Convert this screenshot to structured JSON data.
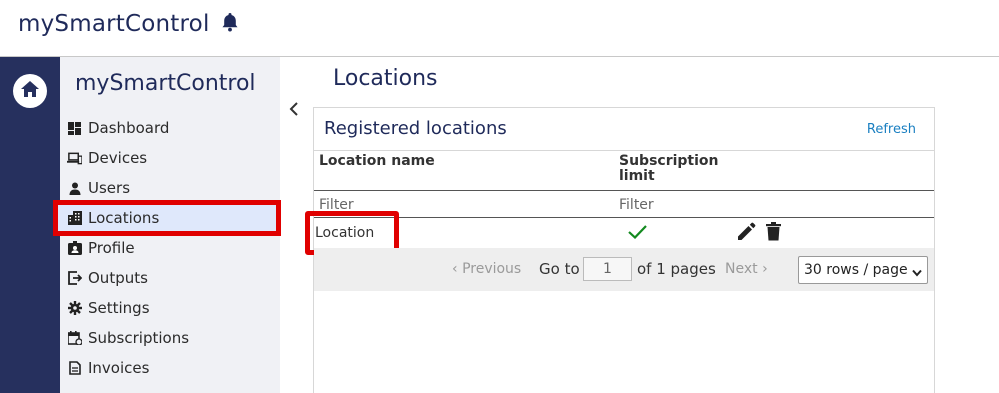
{
  "header": {
    "app_title": "mySmartControl"
  },
  "sidebar": {
    "title": "mySmartControl",
    "items": [
      {
        "label": "Dashboard",
        "icon": "dashboard-icon"
      },
      {
        "label": "Devices",
        "icon": "devices-icon"
      },
      {
        "label": "Users",
        "icon": "user-icon"
      },
      {
        "label": "Locations",
        "icon": "building-icon",
        "active": true
      },
      {
        "label": "Profile",
        "icon": "id-badge-icon"
      },
      {
        "label": "Outputs",
        "icon": "export-icon"
      },
      {
        "label": "Settings",
        "icon": "gear-icon"
      },
      {
        "label": "Subscriptions",
        "icon": "calendar-icon"
      },
      {
        "label": "Invoices",
        "icon": "invoice-icon"
      }
    ]
  },
  "main": {
    "page_title": "Locations",
    "panel": {
      "title": "Registered locations",
      "refresh": "Refresh",
      "columns": {
        "location_name": "Location name",
        "subscription_limit_1": "Subscription",
        "subscription_limit_2": "limit"
      },
      "filters": {
        "location_name": "Filter",
        "subscription_limit": "Filter"
      },
      "rows": [
        {
          "location_name": "Location",
          "subscription_limit": true
        }
      ],
      "pager": {
        "previous": "Previous",
        "goto": "Go to",
        "page": "1",
        "of_pages": "of 1 pages",
        "next": "Next",
        "rows_per_page": "30 rows / page"
      }
    }
  },
  "colors": {
    "brand": "#26305e",
    "highlight": "#e00000",
    "link": "#1a7fc1",
    "success": "#138a1f"
  }
}
